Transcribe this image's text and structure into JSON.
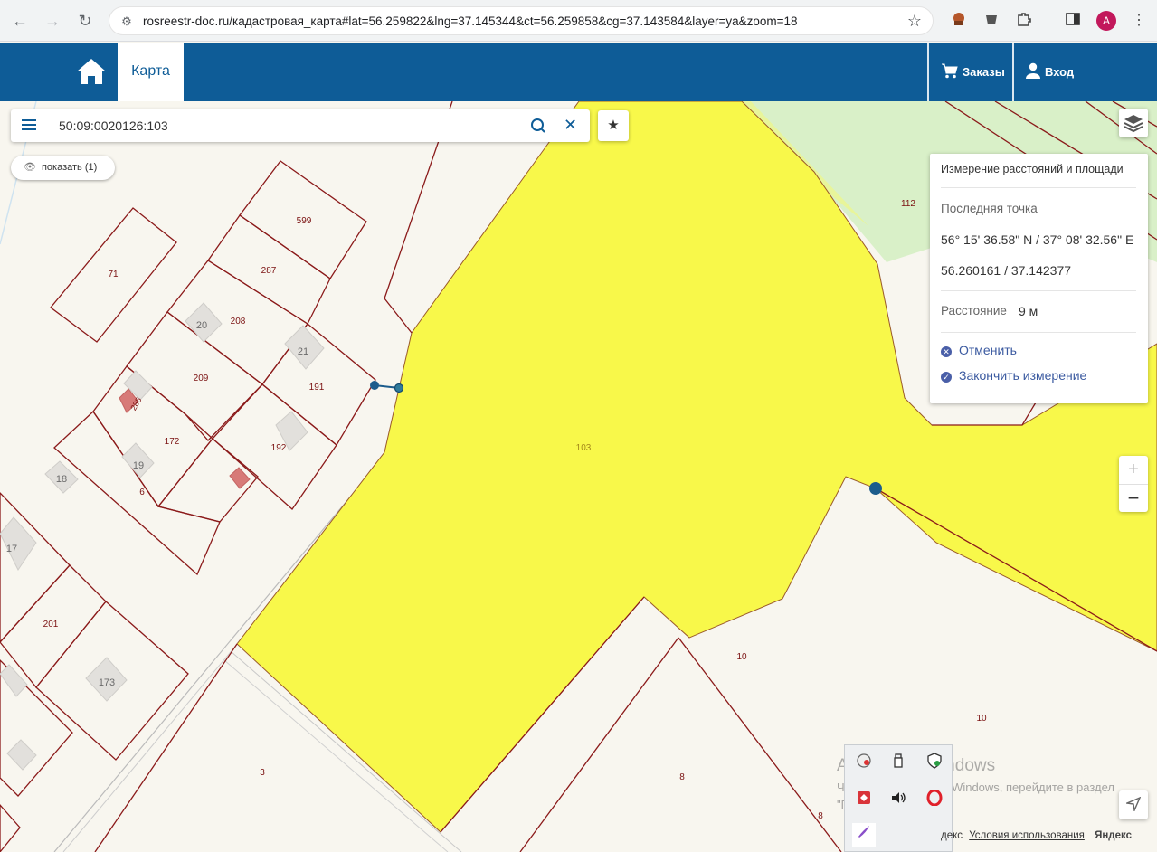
{
  "browser": {
    "url": "rosreestr-doc.ru/кадастровая_карта#lat=56.259822&lng=37.145344&ct=56.259858&cg=37.143584&layer=ya&zoom=18",
    "avatar_letter": "A"
  },
  "header": {
    "tab_map": "Карта",
    "orders": "Заказы",
    "login": "Вход",
    "brand_color": "#0e5c97"
  },
  "search": {
    "value": "50:09:0020126:103"
  },
  "show_button": "показать (1)",
  "measure": {
    "title": "Измерение расстояний и площади",
    "last_point_label": "Последняя точка",
    "dms": "56° 15' 36.58\" N / 37° 08' 32.56\" E",
    "decimal": "56.260161 / 37.142377",
    "distance_label": "Расстояние",
    "distance_value": "9 м",
    "cancel": "Отменить",
    "finish": "Закончить измерение"
  },
  "zoom": {
    "in": "+",
    "out": "−"
  },
  "map_labels": {
    "p599": "599",
    "p287": "287",
    "p71": "71",
    "p20": "20",
    "p208": "208",
    "p21": "21",
    "p209": "209",
    "p191": "191",
    "p285": "285",
    "p172": "172",
    "p192": "192",
    "p19": "19",
    "p18": "18",
    "p6": "6",
    "p17": "17",
    "p201": "201",
    "p173": "173",
    "p3": "3",
    "p8a": "8",
    "p10a": "10",
    "p10b": "10",
    "p8b": "8",
    "p103": "103",
    "p112": "112"
  },
  "watermark": {
    "title": "Активация Windows",
    "sub": "Чтобы активировать Windows, перейдите в раздел \"Параметры\"."
  },
  "attribution": {
    "prefix": "декс",
    "terms": "Условия использования",
    "logo": "Яндекс"
  },
  "icons": {
    "home": "home-icon",
    "cart": "cart-icon",
    "user": "user-icon",
    "layers": "layers-icon",
    "menu": "hamburger-icon",
    "search": "search-icon",
    "clear": "close-icon",
    "star": "star-icon",
    "eye": "eye-icon",
    "locate": "navigation-arrow-icon"
  }
}
